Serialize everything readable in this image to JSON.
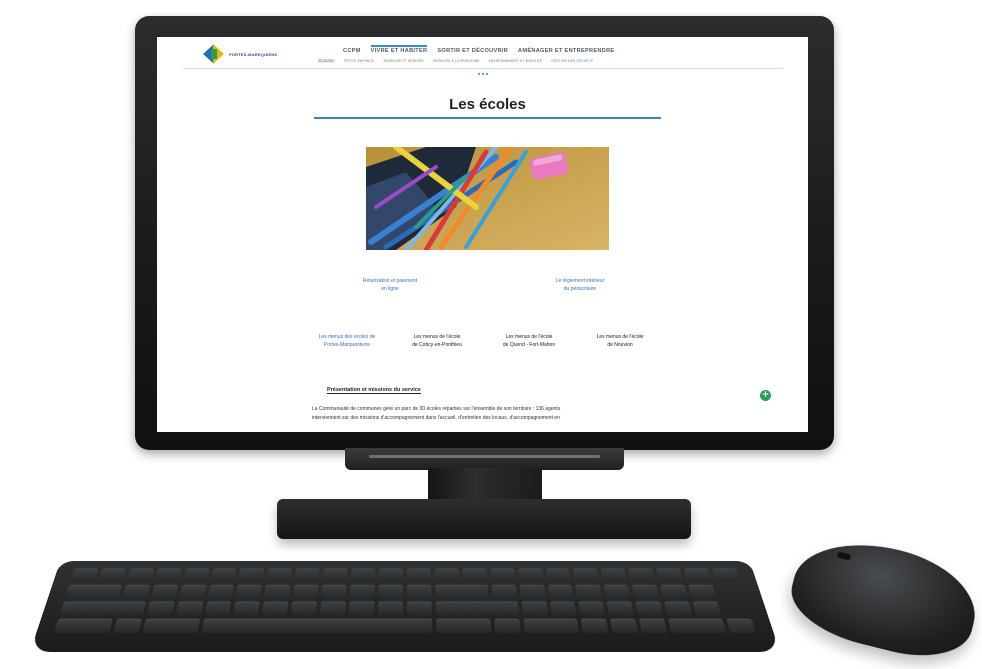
{
  "site": {
    "logo_text": "PORTES-MAREQUIENS"
  },
  "topnav": [
    {
      "label": "CCPM"
    },
    {
      "label": "VIVRE ET HABITER"
    },
    {
      "label": "SORTIR ET DÉCOUVRIR"
    },
    {
      "label": "AMÉNAGER ET ENTREPRENDRE"
    }
  ],
  "subnav": [
    {
      "label": "ÉCOLES"
    },
    {
      "label": "PETITE ENFANCE"
    },
    {
      "label": "JEUNESSE ET SENIORS"
    },
    {
      "label": "SERVICES À LA PERSONNE"
    },
    {
      "label": "ENVIRONNEMENT ET MOBILITÉ"
    },
    {
      "label": "GESTION DES DÉCHETS"
    }
  ],
  "page": {
    "title": "Les écoles",
    "hero_alt": "pencils-and-eraser-photo"
  },
  "links_row1": [
    {
      "line1": "Réservation et paiement",
      "line2": "en ligne"
    },
    {
      "line1": "Le règlement intérieur",
      "line2": "du périscolaire"
    }
  ],
  "links_row2": [
    {
      "line1": "Les menus des écoles de",
      "line2": "Portes-Marquenterre"
    },
    {
      "line1": "Les menus de l'école",
      "line2": "de Cobcy-en-Ponthieu"
    },
    {
      "line1": "Les menus de l'école",
      "line2": "de Quend - Fort-Mahon"
    },
    {
      "line1": "Les menus de l'école",
      "line2": "de Nouvion"
    }
  ],
  "section": {
    "heading": "Présentation et missions du service",
    "paragraph_line1": "La Communauté de communes gère un parc de 30 écoles réparties sur l'ensemble de son territoire : 136 agents",
    "paragraph_line2": "interviennent sur des missions d'accompagnement dans l'accueil, d'entretien des locaux, d'accompagnement en"
  },
  "icons": {
    "expand": "plus-circle-icon"
  },
  "colors": {
    "accent_blue": "#3f7fc6",
    "link_blue": "#3a72b8",
    "accent_green": "#2a9d5a"
  }
}
